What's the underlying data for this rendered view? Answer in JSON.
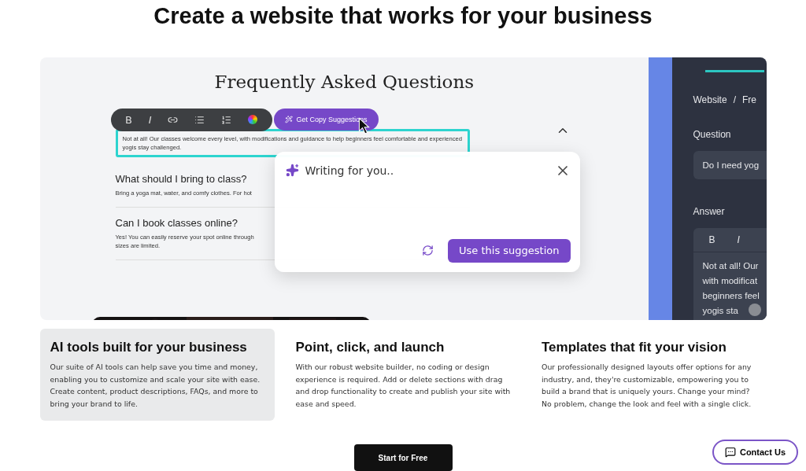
{
  "page_title": "Create a website that works for your business",
  "demo": {
    "faq_heading": "Frequently Asked Questions",
    "toolbar": [
      {
        "kind": "bold",
        "label": "B"
      },
      {
        "kind": "italic",
        "label": "I"
      },
      {
        "kind": "link"
      },
      {
        "kind": "bullets"
      },
      {
        "kind": "numbers"
      },
      {
        "kind": "color"
      }
    ],
    "suggest_button": "Get Copy Suggestions",
    "faqs": [
      {
        "answer": "Not at all! Our classes welcome every level, with modifications and guidance to help beginners feel comfortable and experienced yogis stay challenged.",
        "selected": true
      },
      {
        "question": "What should I bring to class?",
        "answer": "Bring a yoga mat, water, and comfy clothes. For hot",
        "selected": false
      },
      {
        "question": "Can I book classes online?",
        "answer": "Yes! You can easily reserve your spot online through\nsizes are limited.",
        "selected": false
      }
    ],
    "popup": {
      "title": "Writing for you..",
      "action": "Use this suggestion"
    },
    "side_panel": {
      "breadcrumb": [
        "Website",
        "/",
        "Fre"
      ],
      "question_label": "Question",
      "question_value": "Do I need yog",
      "answer_label": "Answer",
      "answer_tools": [
        "B",
        "I"
      ],
      "answer_lines": [
        "Not at all! Our",
        "with modificat",
        "beginners feel",
        "yogis sta"
      ]
    }
  },
  "features": [
    {
      "title": "AI tools built for your business",
      "body": "Our suite of AI tools can help save you time and money, enabling you to customize and scale your site with ease. Create content, product descriptions, FAQs, and more to bring your brand to life.",
      "selected": true
    },
    {
      "title": "Point, click, and launch",
      "body": "With our robust website builder, no coding or design experience is required. Add or delete sections with drag and drop functionality to create and publish your site with ease and speed.",
      "selected": false
    },
    {
      "title": "Templates that fit your vision",
      "body": "Our professionally designed layouts offer options for any industry, and, they're customizable, empowering you to build a brand that is uniquely yours. Change your mind? No problem, change the look and feel with a single click.",
      "selected": false
    }
  ],
  "cta_button": "Start for Free",
  "contact_button": "Contact Us"
}
